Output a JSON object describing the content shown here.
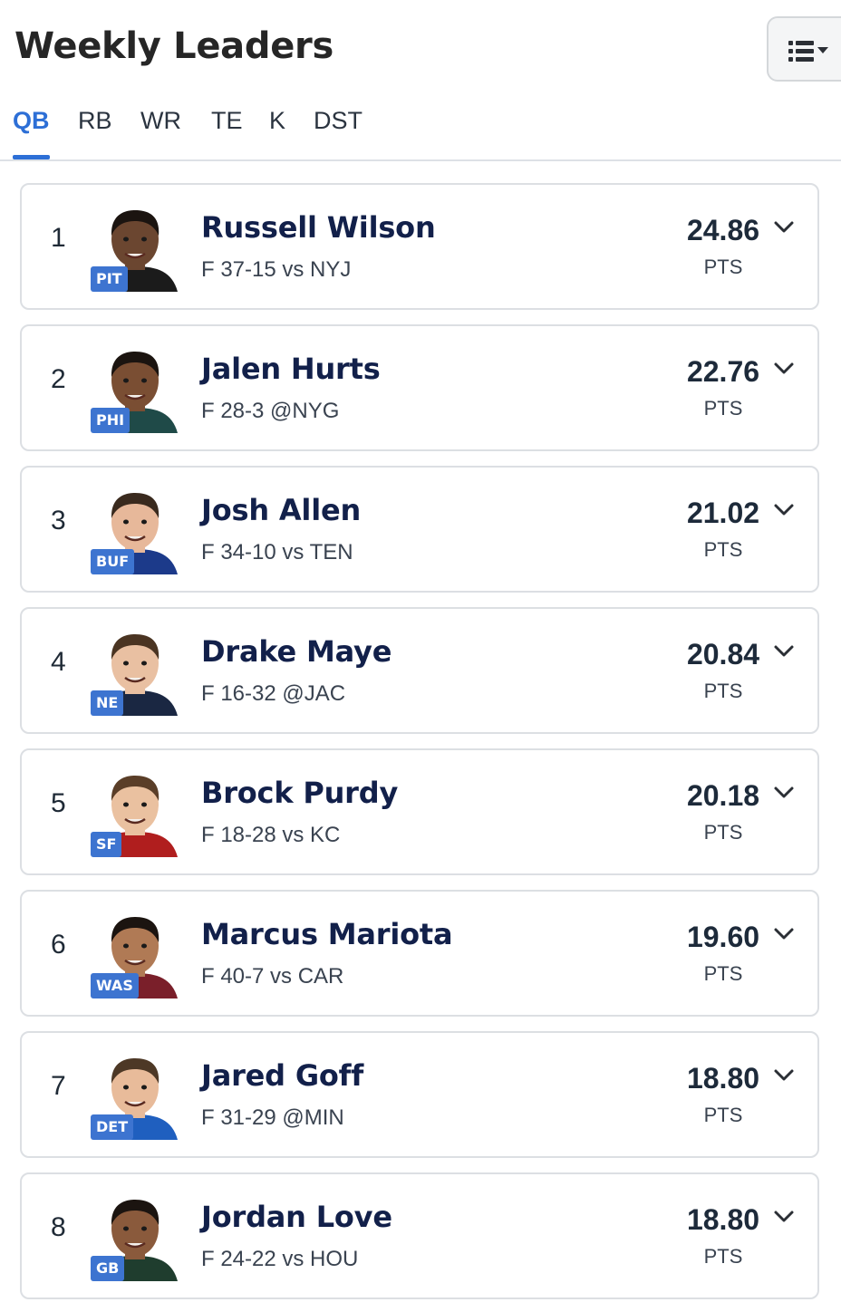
{
  "header": {
    "title": "Weekly Leaders",
    "view_button_icon": "list-view-dropdown-icon"
  },
  "tabs": [
    {
      "label": "QB",
      "active": true
    },
    {
      "label": "RB",
      "active": false
    },
    {
      "label": "WR",
      "active": false
    },
    {
      "label": "TE",
      "active": false
    },
    {
      "label": "K",
      "active": false
    },
    {
      "label": "DST",
      "active": false
    }
  ],
  "colors": {
    "accent": "#2d6fd6",
    "badge": "#3d74d0",
    "name": "#12204a"
  },
  "players": [
    {
      "rank": "1",
      "name": "Russell Wilson",
      "team": "PIT",
      "result": "F 37-15 vs NYJ",
      "points": "24.86",
      "pts_label": "PTS"
    },
    {
      "rank": "2",
      "name": "Jalen Hurts",
      "team": "PHI",
      "result": "F 28-3 @NYG",
      "points": "22.76",
      "pts_label": "PTS"
    },
    {
      "rank": "3",
      "name": "Josh Allen",
      "team": "BUF",
      "result": "F 34-10 vs TEN",
      "points": "21.02",
      "pts_label": "PTS"
    },
    {
      "rank": "4",
      "name": "Drake Maye",
      "team": "NE",
      "result": "F 16-32 @JAC",
      "points": "20.84",
      "pts_label": "PTS"
    },
    {
      "rank": "5",
      "name": "Brock Purdy",
      "team": "SF",
      "result": "F 18-28 vs KC",
      "points": "20.18",
      "pts_label": "PTS"
    },
    {
      "rank": "6",
      "name": "Marcus Mariota",
      "team": "WAS",
      "result": "F 40-7 vs CAR",
      "points": "19.60",
      "pts_label": "PTS"
    },
    {
      "rank": "7",
      "name": "Jared Goff",
      "team": "DET",
      "result": "F 31-29 @MIN",
      "points": "18.80",
      "pts_label": "PTS"
    },
    {
      "rank": "8",
      "name": "Jordan Love",
      "team": "GB",
      "result": "F 24-22 vs HOU",
      "points": "18.80",
      "pts_label": "PTS"
    }
  ]
}
